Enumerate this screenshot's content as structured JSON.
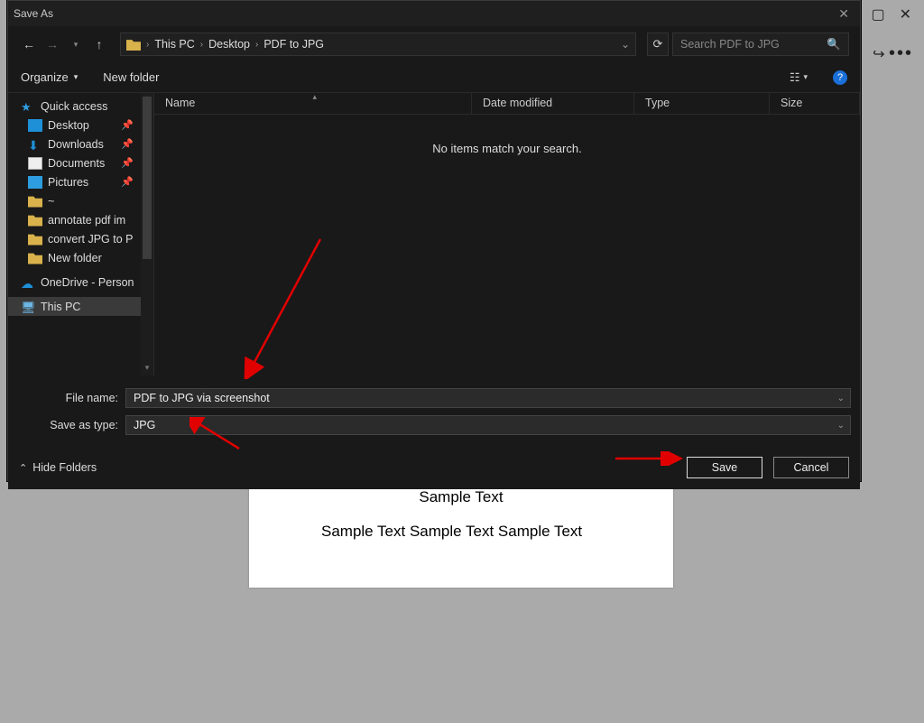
{
  "dialog": {
    "title": "Save As",
    "breadcrumb": {
      "root": "This PC",
      "p1": "Desktop",
      "p2": "PDF to JPG"
    },
    "search_placeholder": "Search PDF to JPG",
    "toolbar": {
      "organize": "Organize",
      "newfolder": "New folder"
    },
    "tree": {
      "quick": "Quick access",
      "desktop": "Desktop",
      "downloads": "Downloads",
      "documents": "Documents",
      "pictures": "Pictures",
      "tilde": "~",
      "annotate": "annotate pdf im",
      "convert": "convert JPG to P",
      "newfolder": "New folder",
      "onedrive": "OneDrive - Person",
      "thispc": "This PC"
    },
    "columns": {
      "name": "Name",
      "date": "Date modified",
      "type": "Type",
      "size": "Size"
    },
    "empty": "No items match your search.",
    "filename_label": "File name:",
    "filename_value": "PDF to JPG via screenshot",
    "type_label": "Save as type:",
    "type_value": "JPG",
    "hide_folders": "Hide Folders",
    "save": "Save",
    "cancel": "Cancel"
  },
  "doc": {
    "line1": "Sample Text",
    "line2": "Sample Text Sample Text Sample Text"
  }
}
